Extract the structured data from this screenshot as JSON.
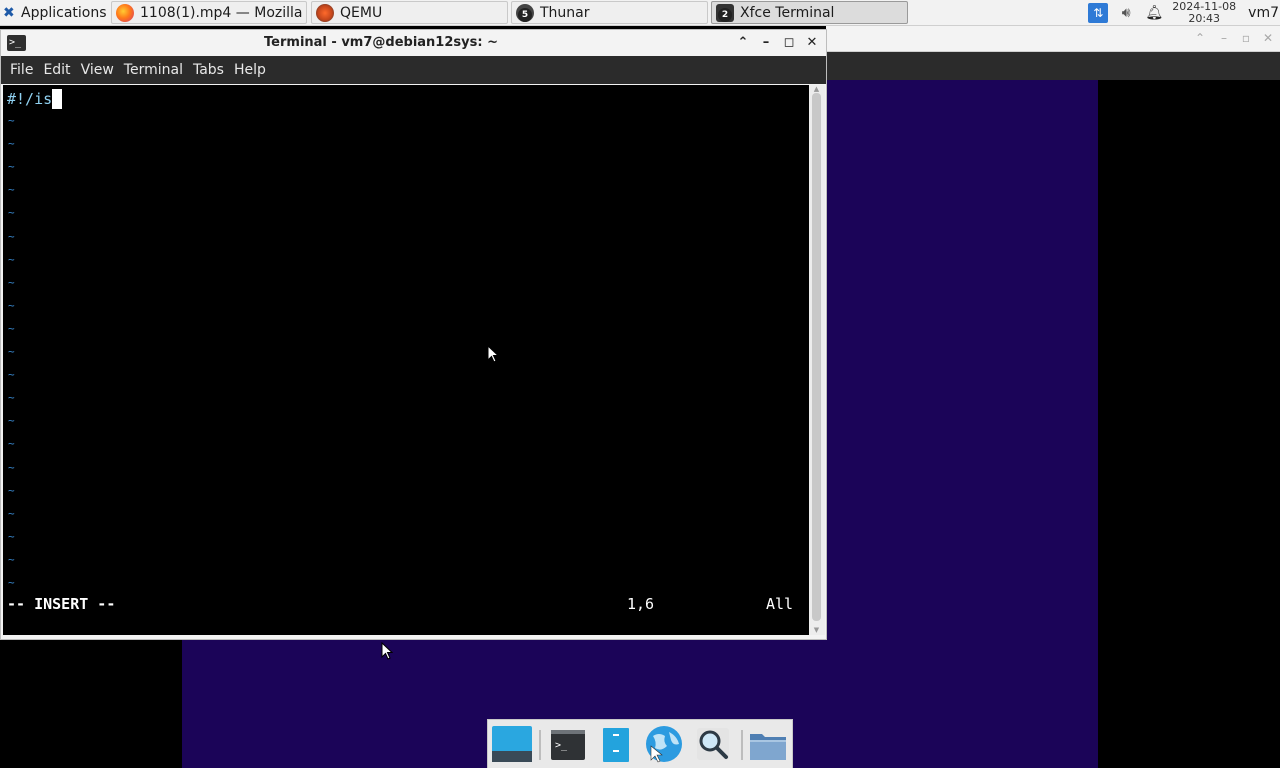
{
  "top_panel": {
    "applications_label": "Applications",
    "tasks": [
      {
        "label": "1108(1).mp4 — Mozilla ...",
        "icon": "firefox-icon"
      },
      {
        "label": "QEMU",
        "icon": "qemu-icon"
      },
      {
        "label": "Thunar",
        "icon": "thunar-icon",
        "badge": "5"
      },
      {
        "label": "Xfce Terminal",
        "icon": "terminal-icon",
        "badge": "2",
        "active": true
      }
    ],
    "clock": {
      "date": "2024-11-08",
      "time": "20:43"
    },
    "user": "vm7"
  },
  "terminal": {
    "title": "Terminal - vm7@debian12sys: ~",
    "menu": [
      "File",
      "Edit",
      "View",
      "Terminal",
      "Tabs",
      "Help"
    ],
    "content_line": "#!/is",
    "tilde": "~",
    "mode": "-- INSERT --",
    "position": "1,6",
    "scroll": "All"
  },
  "colors": {
    "desktop_purple": "#1b0458",
    "terminal_bg": "#000000",
    "vim_text": "#8fd0f0",
    "tilde": "#3a8ad1"
  },
  "dock": {
    "items": [
      "show-desktop",
      "terminal",
      "files",
      "web-browser",
      "app-finder",
      "file-manager"
    ]
  }
}
